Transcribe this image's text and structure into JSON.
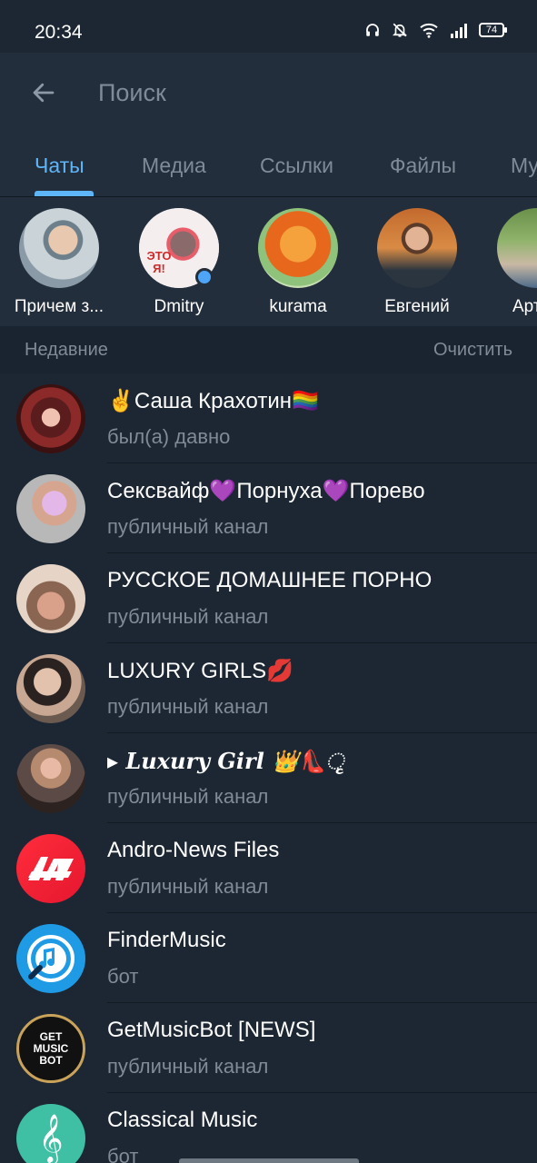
{
  "status": {
    "time": "20:34",
    "battery": "74"
  },
  "search": {
    "placeholder": "Поиск",
    "value": ""
  },
  "tabs": [
    {
      "label": "Чаты",
      "active": true
    },
    {
      "label": "Медиа"
    },
    {
      "label": "Ссылки"
    },
    {
      "label": "Файлы"
    },
    {
      "label": "Му"
    }
  ],
  "people": [
    {
      "name": "Причем з..."
    },
    {
      "name": "Dmitry",
      "online": true
    },
    {
      "name": "kurama"
    },
    {
      "name": "Евгений"
    },
    {
      "name": "Арт"
    }
  ],
  "recent": {
    "title": "Недавние",
    "clear_label": "Очистить",
    "items": [
      {
        "title": "✌️Саша Крахотин🏳️‍🌈",
        "subtitle": "был(а) давно"
      },
      {
        "title": "Сексвайф💜Порнуха💜Порево",
        "subtitle": "публичный канал"
      },
      {
        "title": "РУССКОЕ ДОМАШНЕЕ ПОРНО",
        "subtitle": "публичный канал"
      },
      {
        "title": "LUXURY GIRLS💋",
        "subtitle": "публичный канал"
      },
      {
        "title": "▸ 𝑳𝒖𝒙𝒖𝒓𝒚 𝑮𝒊𝒓𝒍 👑👠ૃ",
        "subtitle": "публичный канал"
      },
      {
        "title": "Andro-News Files",
        "subtitle": "публичный канал"
      },
      {
        "title": "FinderMusic",
        "subtitle": "бот"
      },
      {
        "title": "GetMusicBot [NEWS]",
        "subtitle": "публичный канал"
      },
      {
        "title": "Classical Music",
        "subtitle": "бот"
      }
    ]
  },
  "avatar_labels": {
    "dmitry_text": "ЭТО Я!",
    "getmusic_text": "GET MUSIC BOT"
  },
  "colors": {
    "background": "#1d2733",
    "header": "#232e3c",
    "accent": "#5eb5f7",
    "secondary_text": "#7f8b97"
  }
}
